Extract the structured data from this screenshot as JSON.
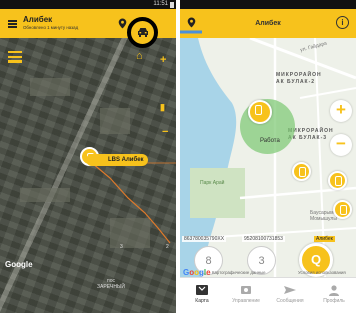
{
  "left_screen": {
    "status_time": "11:51",
    "header": {
      "title": "Алибек",
      "subtitle": "Обновлено 1 минуту назад"
    },
    "map": {
      "lbs_label": "LBS Алибек",
      "place_label_line1": "пос",
      "place_label_line2": "ЗАРЕЧНЫЙ",
      "google_logo": "Google",
      "counters": [
        "3",
        "2"
      ]
    }
  },
  "right_screen": {
    "header": {
      "title": "Алибек"
    },
    "map": {
      "district1": [
        "МИКРОРАЙОН",
        "АК БУЛАК-2"
      ],
      "district2": [
        "МИКРОРАЙОН",
        "АК БУЛАК-3"
      ],
      "zone_label": "Работа",
      "park_label": "Парк Арай",
      "street_top": "ул. Гайдара",
      "place_bottom": [
        "Баусарым",
        "Момышулы"
      ],
      "device_id_1": "863780035790XX",
      "device_id_2": "95208100731853",
      "device_tag": "Алибек",
      "circle_buttons": [
        "8",
        "3"
      ],
      "q_button": "Q",
      "google_logo": "Google",
      "map_credit": "Картографические данные",
      "map_terms": "Условия использования",
      "zoom_in": "+",
      "zoom_out": "−"
    },
    "nav": [
      {
        "label": "Карта",
        "icon": "map-icon",
        "active": true
      },
      {
        "label": "Управление",
        "icon": "settings-icon",
        "active": false
      },
      {
        "label": "Сообщения",
        "icon": "send-icon",
        "active": false
      },
      {
        "label": "Профиль",
        "icon": "profile-icon",
        "active": false
      }
    ]
  },
  "colors": {
    "accent": "#f7c21c",
    "zone": "#7ac870",
    "water": "#a8d4e8"
  }
}
